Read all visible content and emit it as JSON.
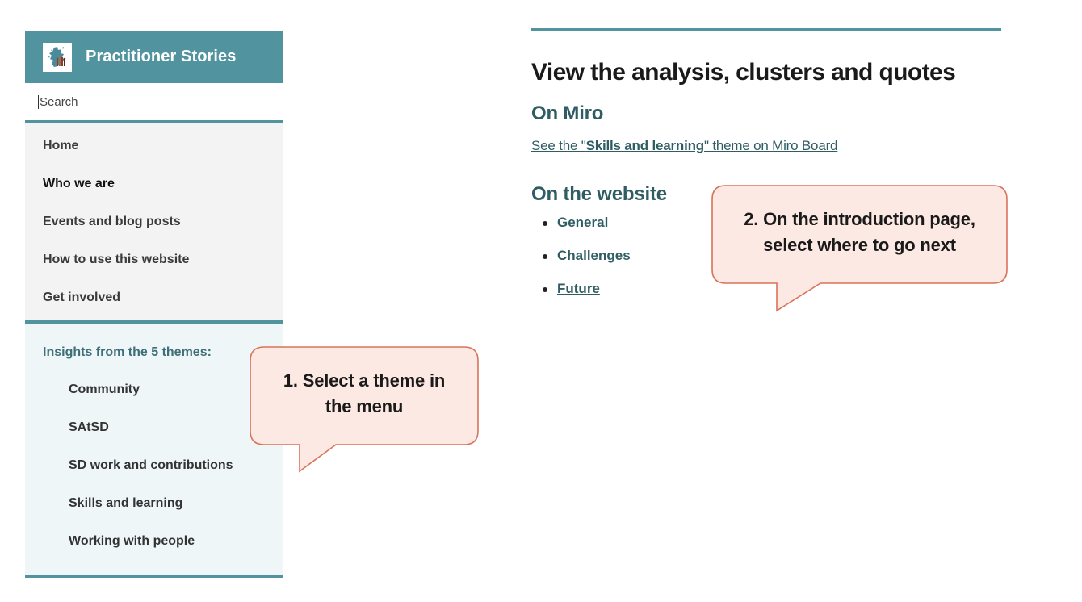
{
  "sidebar": {
    "brand_title": "Practitioner Stories",
    "logo_icon": "scotland-people-logo",
    "search": {
      "placeholder": "Search",
      "value": ""
    },
    "nav_items": [
      {
        "label": "Home"
      },
      {
        "label": "Who we are"
      },
      {
        "label": "Events and blog posts"
      },
      {
        "label": "How to use this website"
      },
      {
        "label": "Get involved"
      }
    ],
    "themes_heading": "Insights from the 5 themes:",
    "themes": [
      {
        "label": "Community"
      },
      {
        "label": "SAtSD"
      },
      {
        "label": "SD work and contributions"
      },
      {
        "label": "Skills and learning"
      },
      {
        "label": "Working with people"
      }
    ]
  },
  "main": {
    "title": "View the analysis, clusters and quotes",
    "miro": {
      "heading": "On Miro",
      "link_prefix": "See the \"",
      "link_bold": "Skills and learning",
      "link_suffix": "\" theme on Miro Board"
    },
    "website": {
      "heading": "On the website",
      "links": [
        {
          "label": "General"
        },
        {
          "label": "Challenges"
        },
        {
          "label": "Future"
        }
      ]
    }
  },
  "callouts": [
    {
      "line1": "1. Select a theme in",
      "line2": "the menu"
    },
    {
      "line1": "2. On the introduction page,",
      "line2": "select where to go next"
    }
  ],
  "colors": {
    "accent": "#51949f",
    "heading_teal": "#2f5d63",
    "callout_fill": "#fde9e4",
    "callout_border": "#d9735a",
    "nav_bg": "#f3f3f3",
    "themes_bg": "#eef6f8"
  }
}
